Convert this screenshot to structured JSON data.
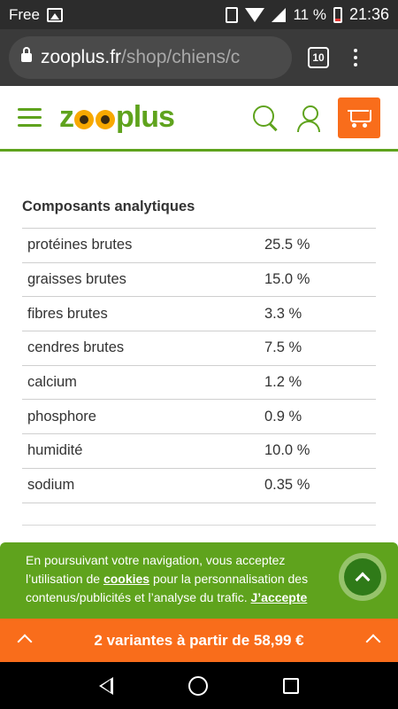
{
  "status_bar": {
    "carrier": "Free",
    "battery_percent": "11 %",
    "time": "21:36",
    "icons": [
      "image-icon",
      "vibrate-icon",
      "wifi-icon",
      "signal-icon",
      "battery-icon"
    ]
  },
  "browser": {
    "url_domain": "zooplus.fr",
    "url_path": "/shop/chiens/c",
    "tab_count": "10"
  },
  "header": {
    "logo_text": "zooplus",
    "accent_color": "#5fa31d",
    "cart_color": "#f96d1b"
  },
  "analysis": {
    "title": "Composants analytiques",
    "rows": [
      {
        "name": "protéines brutes",
        "value": "25.5 %"
      },
      {
        "name": "graisses brutes",
        "value": "15.0 %"
      },
      {
        "name": "fibres brutes",
        "value": "3.3 %"
      },
      {
        "name": "cendres brutes",
        "value": "7.5 %"
      },
      {
        "name": "calcium",
        "value": "1.2 %"
      },
      {
        "name": "phosphore",
        "value": "0.9 %"
      },
      {
        "name": "humidité",
        "value": "10.0 %"
      },
      {
        "name": "sodium",
        "value": "0.35 %"
      }
    ]
  },
  "cookie_banner": {
    "text_before": "En poursuivant votre navigation, vous acceptez l’utilisation de ",
    "cookies_link": "cookies",
    "text_after": " pour la personnalisation des contenus/publicités et l’analyse du trafic. ",
    "accept_link": "J’accepte"
  },
  "variant_bar": {
    "label": "2 variantes à partir de 58,99 €"
  }
}
